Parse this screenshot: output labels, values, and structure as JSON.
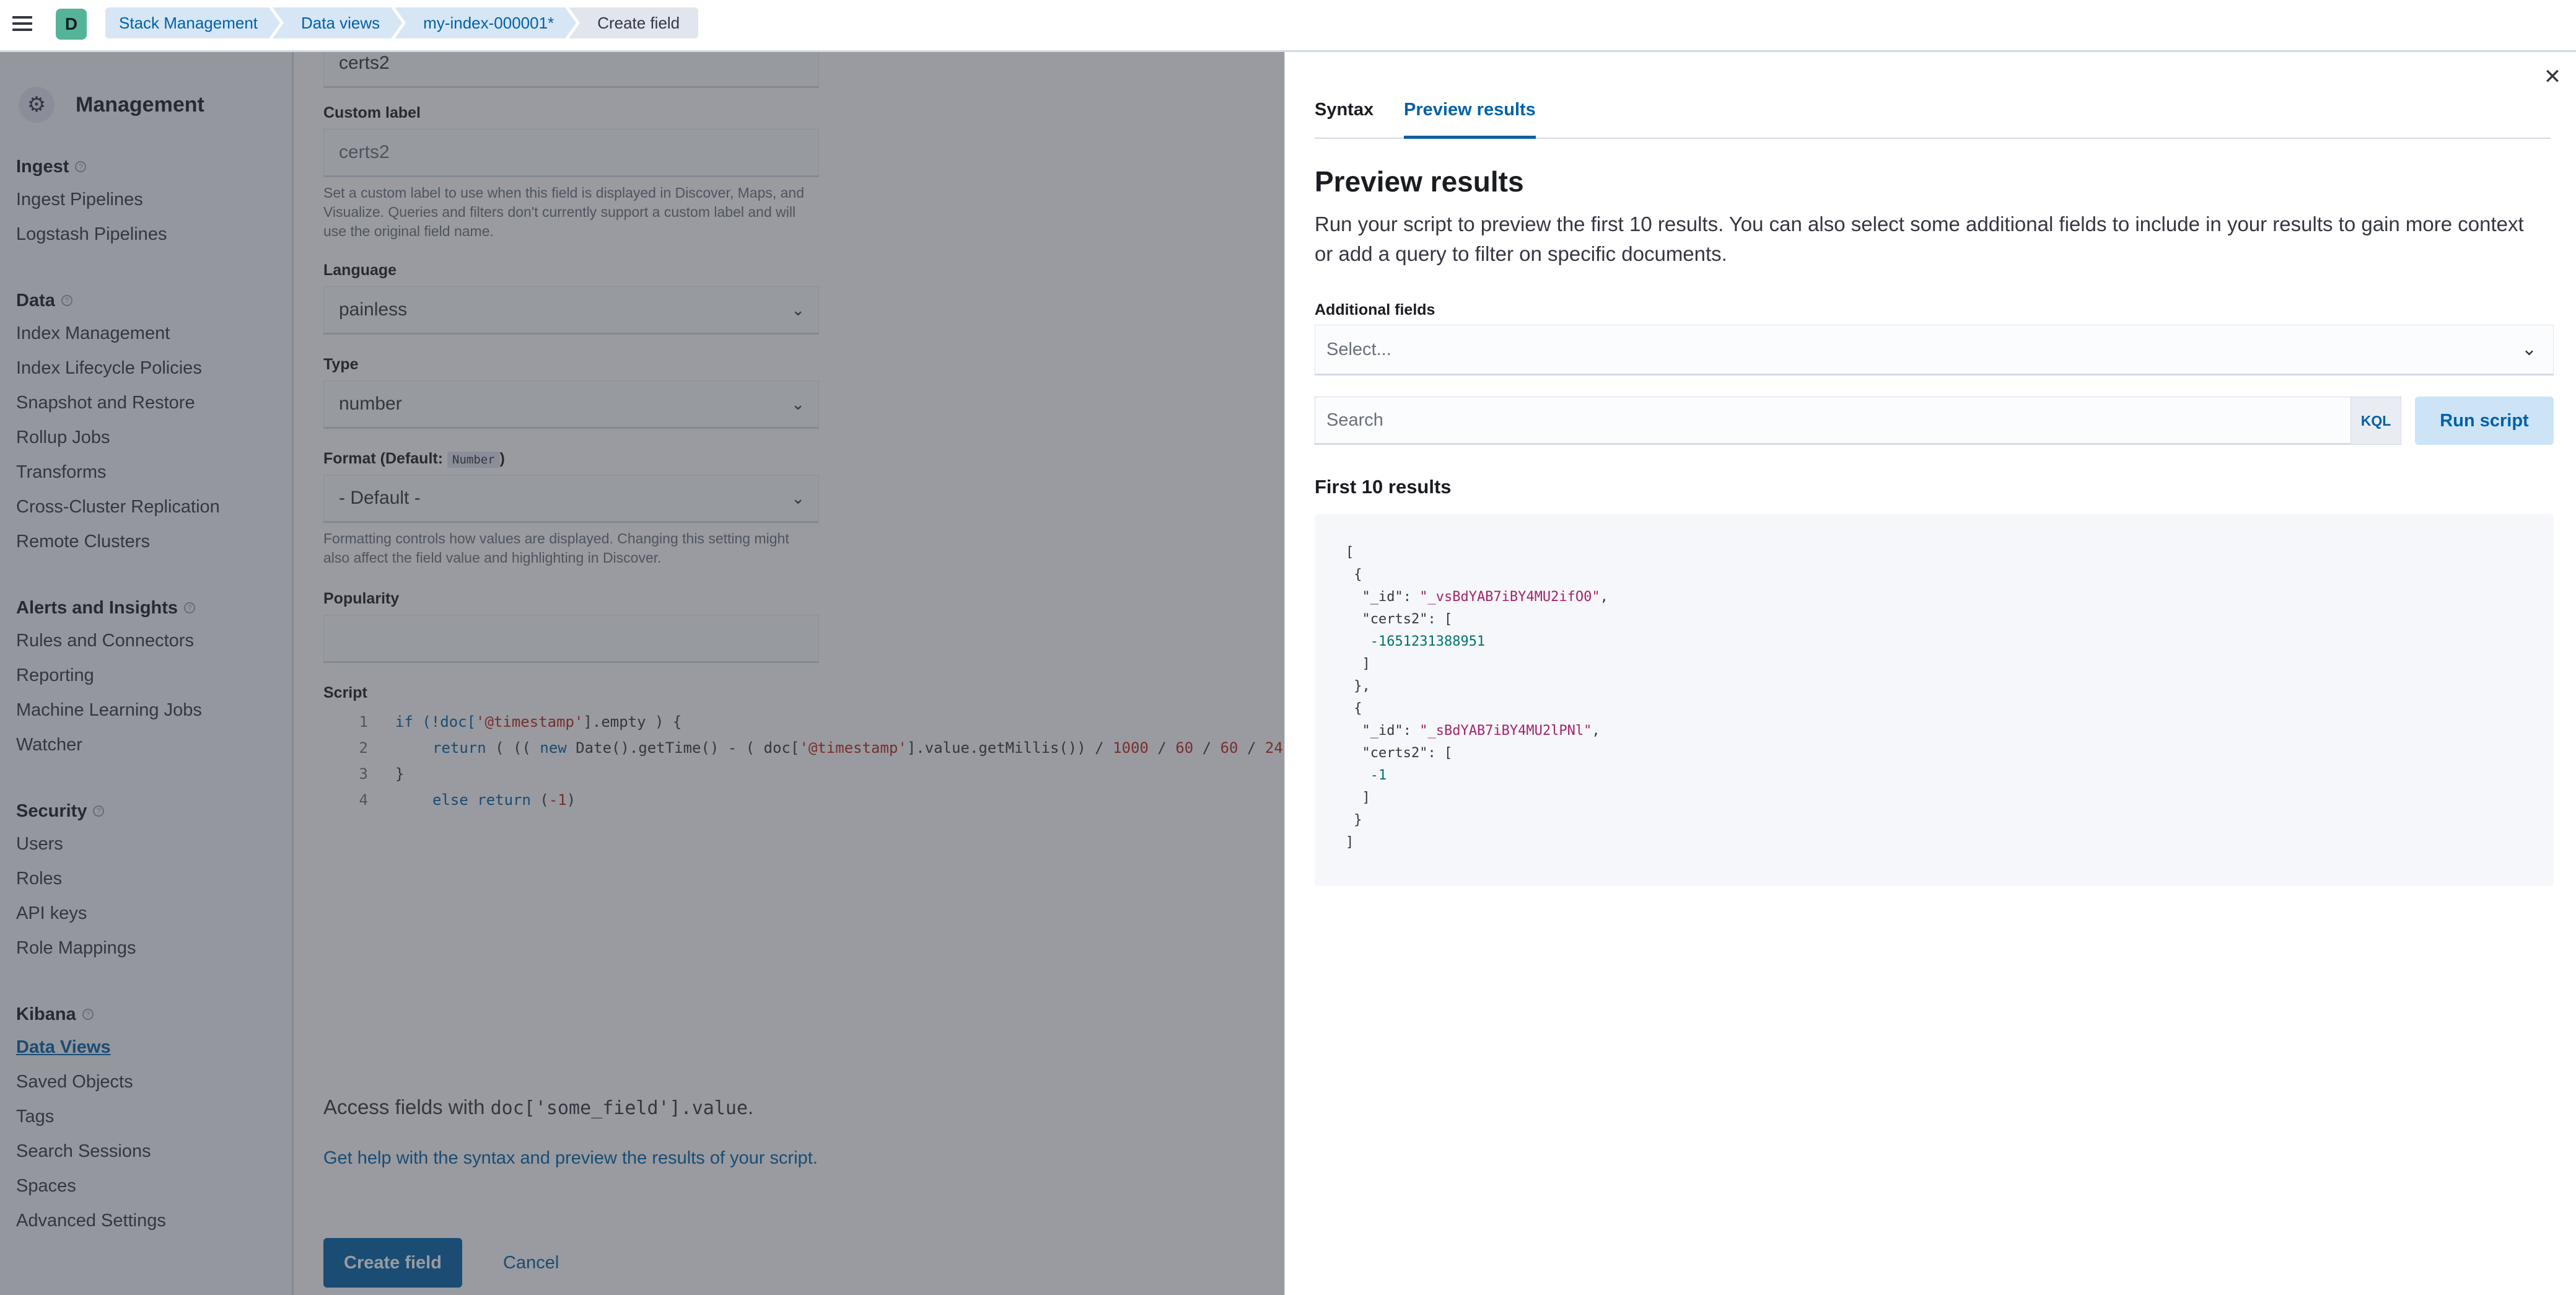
{
  "header": {
    "avatar_letter": "D",
    "breadcrumbs": [
      "Stack Management",
      "Data views",
      "my-index-000001*",
      "Create field"
    ]
  },
  "sidenav": {
    "title": "Management",
    "groups": [
      {
        "title": "Ingest",
        "items": [
          "Ingest Pipelines",
          "Logstash Pipelines"
        ]
      },
      {
        "title": "Data",
        "items": [
          "Index Management",
          "Index Lifecycle Policies",
          "Snapshot and Restore",
          "Rollup Jobs",
          "Transforms",
          "Cross-Cluster Replication",
          "Remote Clusters"
        ]
      },
      {
        "title": "Alerts and Insights",
        "items": [
          "Rules and Connectors",
          "Reporting",
          "Machine Learning Jobs",
          "Watcher"
        ]
      },
      {
        "title": "Security",
        "items": [
          "Users",
          "Roles",
          "API keys",
          "Role Mappings"
        ]
      },
      {
        "title": "Kibana",
        "items": [
          "Data Views",
          "Saved Objects",
          "Tags",
          "Search Sessions",
          "Spaces",
          "Advanced Settings"
        ]
      }
    ],
    "active_item": "Data Views"
  },
  "form": {
    "name_value": "certs2",
    "custom_label": {
      "label": "Custom label",
      "placeholder": "certs2",
      "help": "Set a custom label to use when this field is displayed in Discover, Maps, and Visualize. Queries and filters don't currently support a custom label and will use the original field name."
    },
    "language": {
      "label": "Language",
      "value": "painless"
    },
    "type": {
      "label": "Type",
      "value": "number"
    },
    "format": {
      "label_prefix": "Format (Default: ",
      "badge": "Number",
      "label_suffix": ")",
      "value": "- Default -",
      "help": "Formatting controls how values are displayed. Changing this setting might also affect the field value and highlighting in Discover."
    },
    "popularity": {
      "label": "Popularity",
      "value": ""
    },
    "script": {
      "label": "Script",
      "lines": [
        {
          "n": "1",
          "p1": "if (!doc[",
          "s1": "'@timestamp'",
          "p2": "].empty ) {"
        },
        {
          "n": "2",
          "kw1": "return",
          "p1": " ( (( ",
          "kw2": "new",
          "p2": " Date().getTime() - ( doc[",
          "s1": "'@timestamp'",
          "p3": "].value.getMillis()) / ",
          "n1": "1000",
          "p4": " / ",
          "n2": "60",
          "p5": " / ",
          "n3": "60",
          "p6": " / ",
          "n4": "24"
        },
        {
          "n": "3",
          "p1": "}"
        },
        {
          "n": "4",
          "kw1": "else return",
          "p1": " (",
          "n1": "-1",
          "p2": ")"
        }
      ]
    },
    "access_prefix": "Access fields with ",
    "access_code": "doc['some_field'].value",
    "access_suffix": ".",
    "help_link": "Get help with the syntax and preview the results of your script.",
    "create_button": "Create field",
    "cancel_button": "Cancel"
  },
  "flyout": {
    "tabs": [
      "Syntax",
      "Preview results"
    ],
    "selected_tab": "Preview results",
    "title": "Preview results",
    "description": "Run your script to preview the first 10 results. You can also select some additional fields to include in your results to gain more context or add a query to filter on specific documents.",
    "additional_fields_label": "Additional fields",
    "additional_fields_placeholder": "Select...",
    "search_placeholder": "Search",
    "kql_label": "KQL",
    "run_button": "Run script",
    "results_title": "First 10 results",
    "results": [
      {
        "id": "_vsBdYAB7iBY4MU2ifO0",
        "field": "certs2",
        "value": "-1651231388951"
      },
      {
        "id": "_sBdYAB7iBY4MU2lPNl",
        "field": "certs2",
        "value": "-1"
      }
    ]
  }
}
